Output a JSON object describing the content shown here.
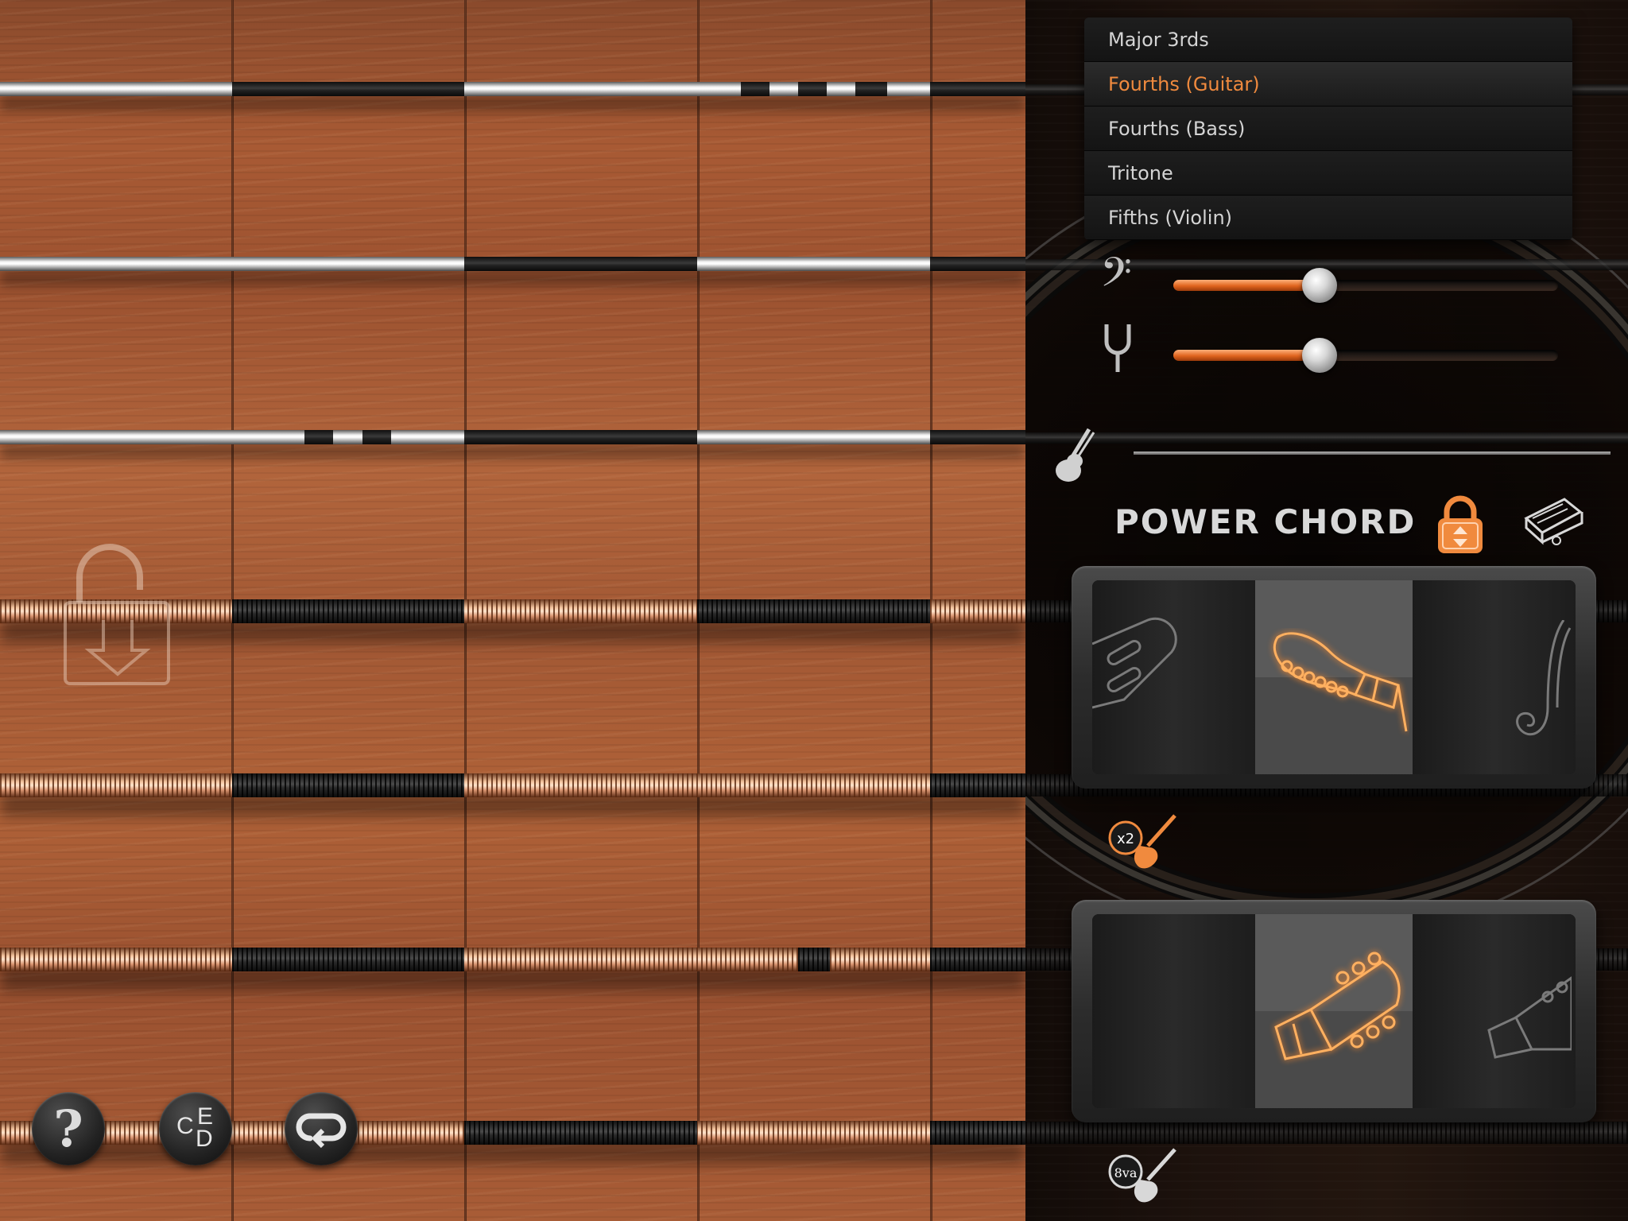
{
  "tuning_options": [
    {
      "label": "Major 3rds",
      "selected": false
    },
    {
      "label": "Fourths (Guitar)",
      "selected": true
    },
    {
      "label": "Fourths (Bass)",
      "selected": false
    },
    {
      "label": "Tritone",
      "selected": false
    },
    {
      "label": "Fifths (Violin)",
      "selected": false
    }
  ],
  "volume_slider": {
    "icon": "bass-clef-icon",
    "glyph": "𝄢",
    "value": 0.38
  },
  "tune_slider": {
    "icon": "tuning-fork-icon",
    "value": 0.38
  },
  "mode": {
    "title": "POWER CHORD",
    "locked": true
  },
  "instrument_selector": {
    "options": [
      "bass-headstock",
      "electric-guitar-headstock",
      "violin-scroll"
    ],
    "selected": "electric-guitar-headstock"
  },
  "octave_selector": {
    "options": [
      "blank",
      "acoustic-guitar-headstock",
      "guitar-headstock-faded"
    ],
    "selected": "acoustic-guitar-headstock"
  },
  "toggles": {
    "double_strings_label": "x2",
    "octave_label": "8va"
  },
  "buttons": {
    "help_label": "?",
    "notes_labels": {
      "c": "C",
      "e": "E",
      "d": "D"
    }
  },
  "colors": {
    "accent": "#f08a3e",
    "wood": "#a85a34",
    "panel": "#1d120d"
  }
}
